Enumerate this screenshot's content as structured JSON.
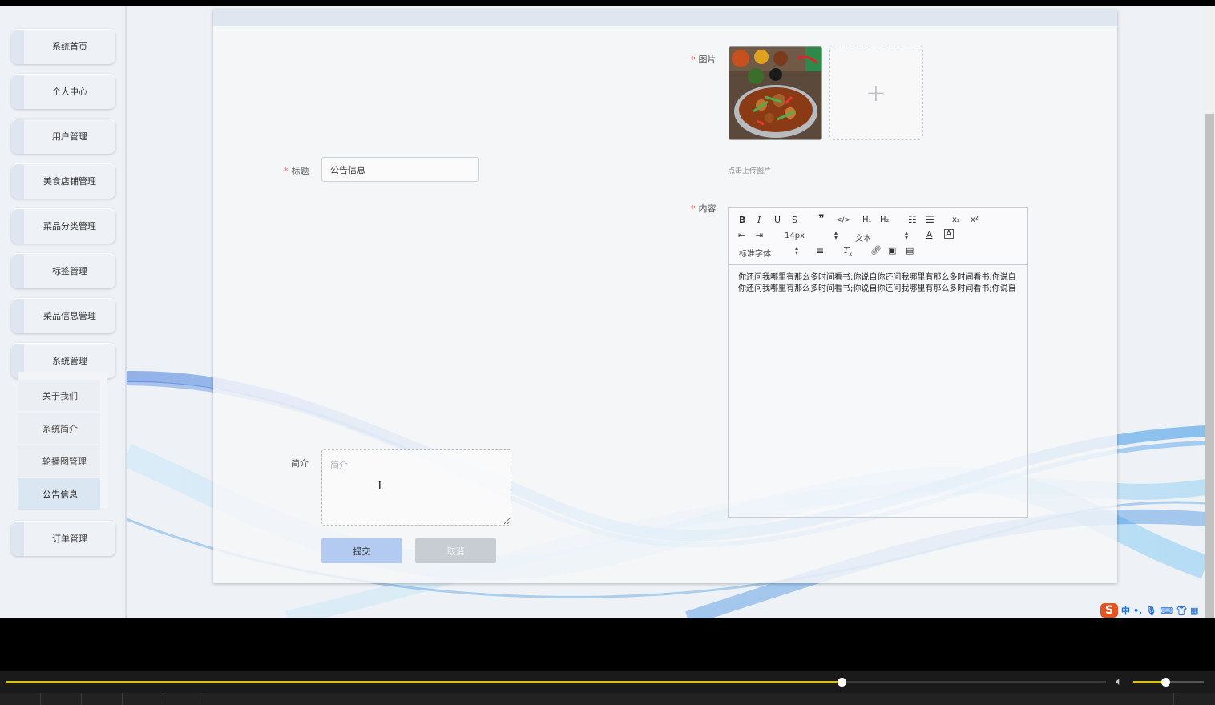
{
  "sidebar": {
    "items": [
      {
        "label": "系统首页"
      },
      {
        "label": "个人中心"
      },
      {
        "label": "用户管理"
      },
      {
        "label": "美食店铺管理"
      },
      {
        "label": "菜品分类管理"
      },
      {
        "label": "标签管理"
      },
      {
        "label": "菜品信息管理"
      },
      {
        "label": "系统管理"
      }
    ],
    "submenu": [
      {
        "label": "关于我们"
      },
      {
        "label": "系统简介"
      },
      {
        "label": "轮播图管理"
      },
      {
        "label": "公告信息",
        "active": true
      }
    ],
    "last_item": {
      "label": "订单管理"
    }
  },
  "form": {
    "title_label": "标题",
    "title_value": "公告信息",
    "summary_label": "简介",
    "summary_placeholder": "简介",
    "image_label": "图片",
    "upload_tip": "点击上传图片",
    "content_label": "内容",
    "submit_label": "提交",
    "cancel_label": "取消"
  },
  "editor": {
    "font_size": "14px",
    "header_select": "文本",
    "font_family": "标准字体",
    "content": "你还问我哪里有那么多时间看书;你说自你还问我哪里有那么多时间看书;你说自你还问我哪里有那么多时间看书;你说自你还问我哪里有那么多时间看书;你说自"
  },
  "ime": {
    "logo": "S",
    "mode": "中",
    "punct": "•,"
  },
  "player": {
    "progress": 0.76,
    "volume": 0.45
  },
  "colors": {
    "required": "#f56c6c",
    "submit": "#b3cbf0",
    "cancel": "#c8ccd3",
    "seek": "#d8c21a"
  }
}
